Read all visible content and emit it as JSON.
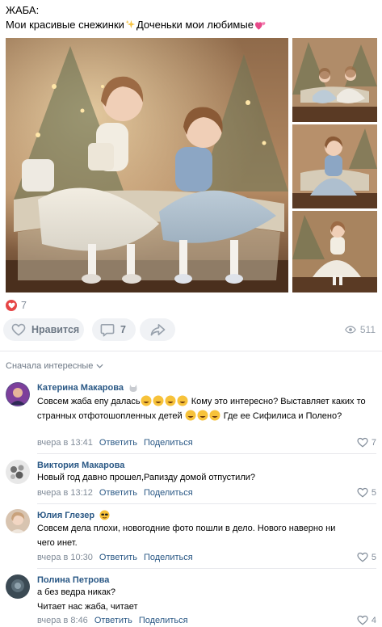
{
  "post": {
    "title": "ЖАБА:",
    "text_before_sparkle": "Мои красивые снежинки",
    "text_after_sparkle": "Доченьки мои любимые"
  },
  "reactions": {
    "count": "7"
  },
  "actions": {
    "like_label": "Нравится",
    "comments_count": "7",
    "views_count": "511"
  },
  "sort": {
    "label": "Сначала интересные"
  },
  "comments": [
    {
      "author": "Катерина Макарова",
      "text_part1": "Совсем жаба епу далась",
      "text_part2": " Кому это интересно? Выставляет каких то странных отфотошопленных детей",
      "text_part3": " Где ее Сифилиса и Полено?",
      "time": "вчера в 13:41",
      "reply": "Ответить",
      "share": "Поделиться",
      "likes": "7"
    },
    {
      "author": "Виктория Макарова",
      "text": "Новый год давно прошел,Рапизду домой отпустили?",
      "time": "вчера в 13:12",
      "reply": "Ответить",
      "share": "Поделиться",
      "likes": "5"
    },
    {
      "author": "Юлия Глезер",
      "text_line1": "Совсем дела плохи, новогодние фото пошли в дело. Нового наверно ни",
      "text_line2": "чего инет.",
      "time": "вчера в 10:30",
      "reply": "Ответить",
      "share": "Поделиться",
      "likes": "5"
    },
    {
      "author": "Полина Петрова",
      "text_line1": "а без ведра никак?",
      "text_line2": "Читает нас жаба, читает",
      "time": "вчера в 8:46",
      "reply": "Ответить",
      "share": "Поделиться",
      "likes": "4"
    }
  ],
  "colors": {
    "link": "#2a5885",
    "secondary": "#818c99",
    "button_bg": "#f0f2f5",
    "reaction": "#e64646"
  }
}
